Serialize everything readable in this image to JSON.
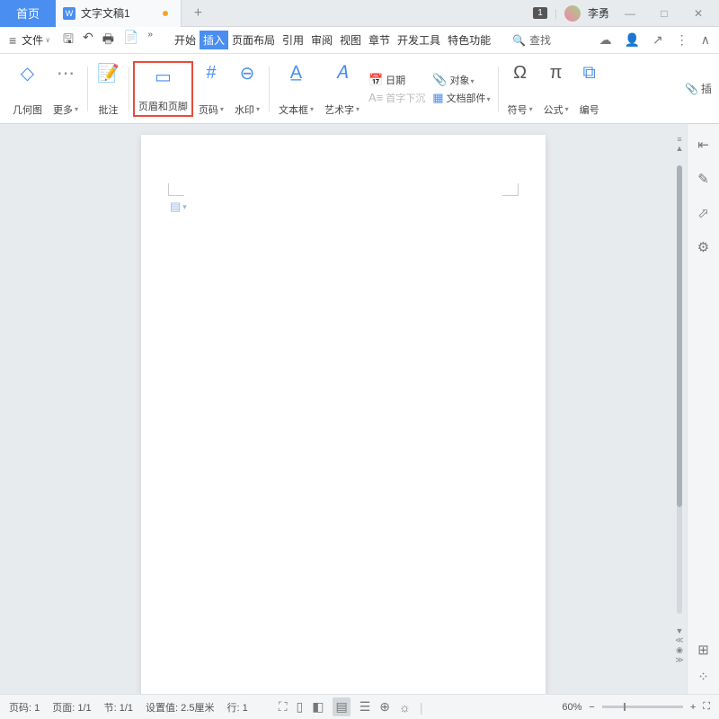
{
  "titlebar": {
    "home_tab": "首页",
    "doc_tab": "文字文稿1",
    "doc_icon": "W",
    "badge": "1",
    "username": "李勇"
  },
  "menubar": {
    "file": "文件",
    "tabs": [
      "开始",
      "插入",
      "页面布局",
      "引用",
      "审阅",
      "视图",
      "章节",
      "开发工具",
      "特色功能"
    ],
    "active_index": 1,
    "search": "查找"
  },
  "ribbon": {
    "geom": "几何图",
    "more": "更多",
    "comment": "批注",
    "header_footer": "页眉和页脚",
    "page_num": "页码",
    "watermark": "水印",
    "textbox": "文本框",
    "wordart": "艺术字",
    "date": "日期",
    "dropcap": "首字下沉",
    "object": "对象",
    "docparts": "文档部件",
    "symbol": "符号",
    "equation": "公式",
    "number": "编号",
    "attach": "插"
  },
  "statusbar": {
    "page_no": "页码: 1",
    "page_of": "页面: 1/1",
    "section": "节: 1/1",
    "pos": "设置值: 2.5厘米",
    "line": "行: 1",
    "zoom": "60%"
  }
}
